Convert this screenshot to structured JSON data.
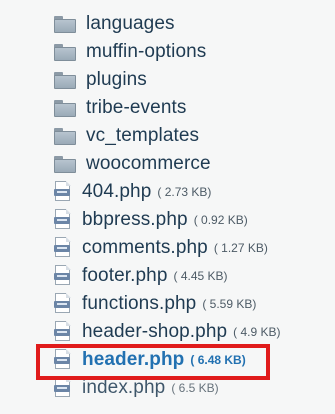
{
  "file_tree": {
    "items": [
      {
        "type": "folder",
        "name": "languages",
        "icon": "folder-icon"
      },
      {
        "type": "folder",
        "name": "muffin-options",
        "icon": "folder-icon"
      },
      {
        "type": "folder",
        "name": "plugins",
        "icon": "folder-icon"
      },
      {
        "type": "folder",
        "name": "tribe-events",
        "icon": "folder-icon"
      },
      {
        "type": "folder",
        "name": "vc_templates",
        "icon": "folder-icon"
      },
      {
        "type": "folder",
        "name": "woocommerce",
        "icon": "folder-icon"
      },
      {
        "type": "file",
        "name": "404.php",
        "size": "( 2.73 KB)",
        "icon": "php-file-icon"
      },
      {
        "type": "file",
        "name": "bbpress.php",
        "size": "( 0.92 KB)",
        "icon": "php-file-icon"
      },
      {
        "type": "file",
        "name": "comments.php",
        "size": "( 1.27 KB)",
        "icon": "php-file-icon"
      },
      {
        "type": "file",
        "name": "footer.php",
        "size": "( 4.45 KB)",
        "icon": "php-file-icon"
      },
      {
        "type": "file",
        "name": "functions.php",
        "size": "( 5.59 KB)",
        "icon": "php-file-icon"
      },
      {
        "type": "file",
        "name": "header-shop.php",
        "size": "( 4.9 KB)",
        "icon": "php-file-icon"
      },
      {
        "type": "file",
        "name": "header.php",
        "size": "( 6.48 KB)",
        "icon": "php-file-icon",
        "active": true
      },
      {
        "type": "file",
        "name": "index.php",
        "size": "( 6.5 KB)",
        "icon": "php-file-icon"
      }
    ],
    "highlight_color": "#e01b1b",
    "active_color": "#2271b1"
  }
}
